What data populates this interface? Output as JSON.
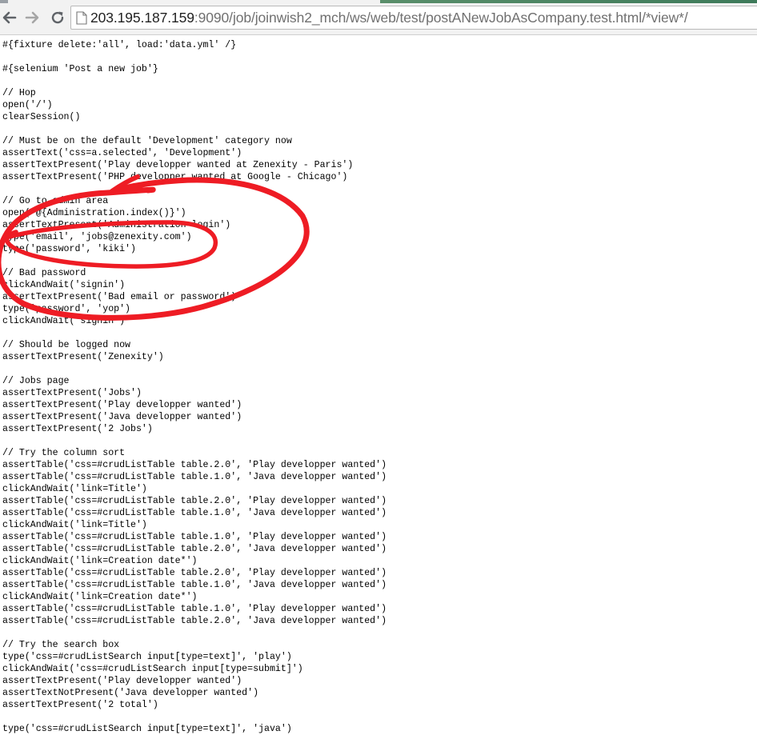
{
  "browser": {
    "url_host": "203.195.187.159",
    "url_rest": ":9090/job/joinwish2_mch/ws/web/test/postANewJobAsCompany.test.html/*view*/",
    "back_icon": "back-arrow-icon",
    "forward_icon": "forward-arrow-icon",
    "reload_icon": "reload-icon",
    "page_icon": "page-icon"
  },
  "code": {
    "lines": [
      "#{fixture delete:'all', load:'data.yml' /}",
      "",
      "#{selenium 'Post a new job'}",
      "",
      "// Hop",
      "open('/')",
      "clearSession()",
      "",
      "// Must be on the default 'Development' category now",
      "assertText('css=a.selected', 'Development')",
      "assertTextPresent('Play developper wanted at Zenexity - Paris')",
      "assertTextPresent('PHP developper wanted at Google - Chicago')",
      "",
      "// Go to admin area",
      "open('@{Administration.index()}')",
      "assertTextPresent('Administration login')",
      "type('email', 'jobs@zenexity.com')",
      "type('password', 'kiki')",
      "",
      "// Bad password",
      "clickAndWait('signin')",
      "assertTextPresent('Bad email or password')",
      "type('password', 'yop')",
      "clickAndWait('signin')",
      "",
      "// Should be logged now",
      "assertTextPresent('Zenexity')",
      "",
      "// Jobs page",
      "assertTextPresent('Jobs')",
      "assertTextPresent('Play developper wanted')",
      "assertTextPresent('Java developper wanted')",
      "assertTextPresent('2 Jobs')",
      "",
      "// Try the column sort",
      "assertTable('css=#crudListTable table.2.0', 'Play developper wanted')",
      "assertTable('css=#crudListTable table.1.0', 'Java developper wanted')",
      "clickAndWait('link=Title')",
      "assertTable('css=#crudListTable table.2.0', 'Play developper wanted')",
      "assertTable('css=#crudListTable table.1.0', 'Java developper wanted')",
      "clickAndWait('link=Title')",
      "assertTable('css=#crudListTable table.1.0', 'Play developper wanted')",
      "assertTable('css=#crudListTable table.2.0', 'Java developper wanted')",
      "clickAndWait('link=Creation date*')",
      "assertTable('css=#crudListTable table.2.0', 'Play developper wanted')",
      "assertTable('css=#crudListTable table.1.0', 'Java developper wanted')",
      "clickAndWait('link=Creation date*')",
      "assertTable('css=#crudListTable table.1.0', 'Play developper wanted')",
      "assertTable('css=#crudListTable table.2.0', 'Java developper wanted')",
      "",
      "// Try the search box",
      "type('css=#crudListSearch input[type=text]', 'play')",
      "clickAndWait('css=#crudListSearch input[type=submit]')",
      "assertTextPresent('Play developper wanted')",
      "assertTextNotPresent('Java developper wanted')",
      "assertTextPresent('2 total')",
      "",
      "type('css=#crudListSearch input[type=text]', 'java')"
    ]
  },
  "annotation": {
    "color": "#ee1c24",
    "shape": "hand-drawn-circle"
  }
}
